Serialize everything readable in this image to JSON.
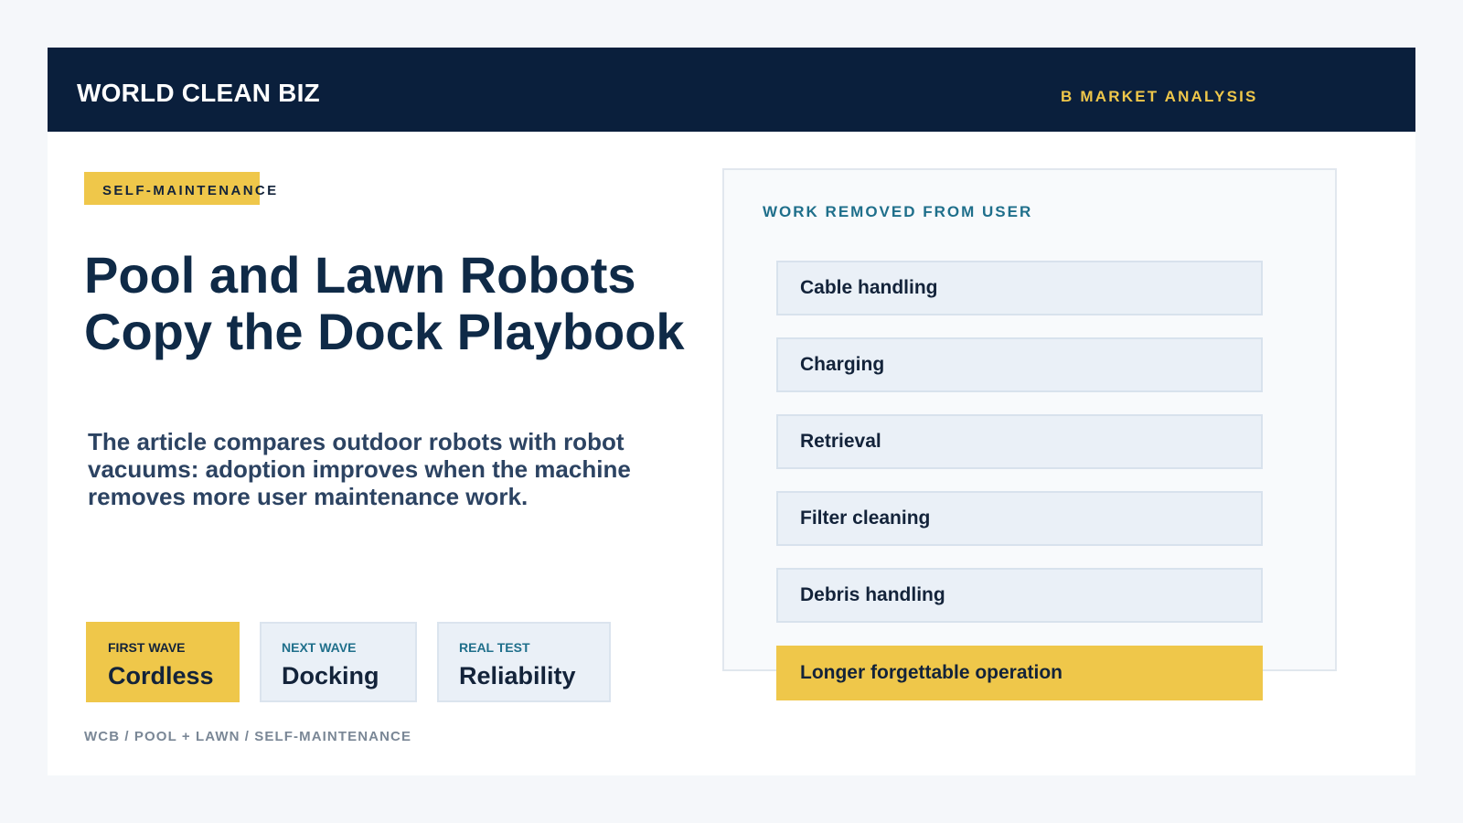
{
  "header": {
    "brand": "WORLD CLEAN BIZ",
    "section": "B MARKET ANALYSIS"
  },
  "tag": "SELF-MAINTENANCE",
  "title": {
    "line1": "Pool and Lawn Robots",
    "line2": "Copy the Dock Playbook"
  },
  "summary": "The article compares outdoor robots with robot vacuums: adoption improves when the machine removes more user maintenance work.",
  "waves": [
    {
      "label": "FIRST WAVE",
      "value": "Cordless"
    },
    {
      "label": "NEXT WAVE",
      "value": "Docking"
    },
    {
      "label": "REAL TEST",
      "value": "Reliability"
    }
  ],
  "footer": "WCB / POOL + LAWN / SELF-MAINTENANCE",
  "panel": {
    "title": "WORK REMOVED FROM USER",
    "items": [
      "Cable handling",
      "Charging",
      "Retrieval",
      "Filter cleaning",
      "Debris handling",
      "Longer forgettable operation"
    ]
  },
  "colors": {
    "navy": "#0a1f3c",
    "accent_yellow": "#efc74a",
    "teal": "#1f6f8b",
    "light_panel": "#eaf0f7"
  }
}
